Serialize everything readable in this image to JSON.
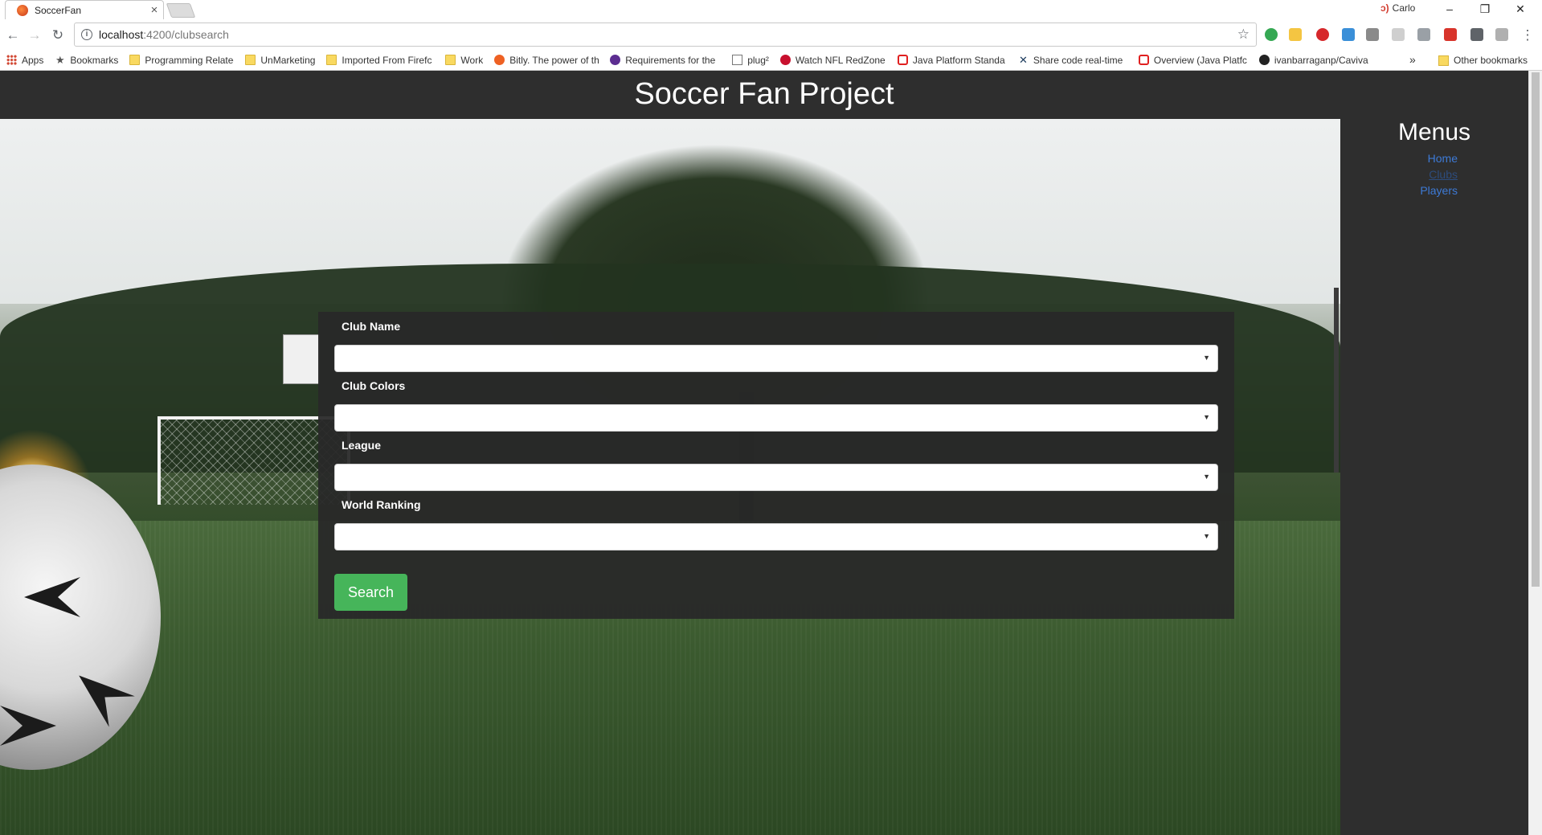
{
  "browser": {
    "tab_title": "SoccerFan",
    "tab_close": "×",
    "profile_name": "Carlo",
    "window_controls": [
      "–",
      "❐",
      "✕"
    ],
    "url_host": "localhost",
    "url_path": ":4200/clubsearch",
    "bookmarks": [
      {
        "label": "Apps",
        "icon": "apps-icon"
      },
      {
        "label": "Bookmarks",
        "icon": "star-icon"
      },
      {
        "label": "Programming Relatec",
        "icon": "folder-icon"
      },
      {
        "label": "UnMarketing",
        "icon": "folder-icon"
      },
      {
        "label": "Imported From Firefc",
        "icon": "folder-icon"
      },
      {
        "label": "Work",
        "icon": "folder-icon"
      },
      {
        "label": "Bitly. The power of th",
        "icon": "bitly-icon"
      },
      {
        "label": "Requirements for the",
        "icon": "site-icon"
      },
      {
        "label": "plug²",
        "icon": "page-icon"
      },
      {
        "label": "Watch NFL RedZone",
        "icon": "nfl-icon"
      },
      {
        "label": "Java Platform Standa",
        "icon": "oracle-icon"
      },
      {
        "label": "Share code real-time",
        "icon": "codeshare-icon"
      },
      {
        "label": "Overview (Java Platfc",
        "icon": "oracle-icon"
      },
      {
        "label": "ivanbarraganp/Caviva",
        "icon": "github-icon"
      }
    ],
    "bookmarks_overflow": "»",
    "other_bookmarks": "Other bookmarks"
  },
  "site": {
    "title": "Soccer Fan Project"
  },
  "sidebar": {
    "title": "Menus",
    "links": [
      {
        "label": "Home",
        "visited": false
      },
      {
        "label": "Clubs",
        "visited": true
      },
      {
        "label": "Players",
        "visited": false
      }
    ]
  },
  "form": {
    "fields": [
      {
        "label": "Club Name",
        "value": ""
      },
      {
        "label": "Club Colors",
        "value": ""
      },
      {
        "label": "League",
        "value": ""
      },
      {
        "label": "World Ranking",
        "value": ""
      }
    ],
    "submit_label": "Search"
  },
  "colors": {
    "header_bg": "#2e2e2e",
    "link": "#3d7ad6",
    "button": "#46b55a"
  }
}
